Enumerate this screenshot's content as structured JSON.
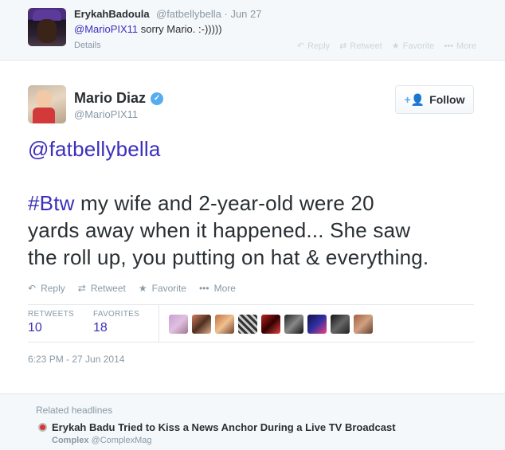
{
  "parent_tweet": {
    "name": "ErykahBadoula",
    "handle": "@fatbellybella",
    "date": "Jun 27",
    "mention": "@MarioPIX11",
    "text": " sorry Mario. :-)))))",
    "details_label": "Details",
    "actions": {
      "reply": "Reply",
      "retweet": "Retweet",
      "favorite": "Favorite",
      "more": "More"
    }
  },
  "main_tweet": {
    "name": "Mario Diaz",
    "handle": "@MarioPIX11",
    "follow_label": "Follow",
    "text_mention": "@fatbellybella",
    "hashtag": "#Btw",
    "line1_rest": " my wife and 2-year-old were 20",
    "line2": "yards away when it happened... She saw",
    "line3": "the roll up, you putting on hat & everything.",
    "actions": {
      "reply": "Reply",
      "retweet": "Retweet",
      "favorite": "Favorite",
      "more": "More"
    },
    "stats": {
      "retweets_label": "RETWEETS",
      "retweets_value": "10",
      "favorites_label": "FAVORITES",
      "favorites_value": "18"
    },
    "timestamp": "6:23 PM - 27 Jun 2014"
  },
  "related": {
    "title": "Related headlines",
    "headline": "Erykah Badu Tried to Kiss a News Anchor During a Live TV Broadcast",
    "source_name": "Complex",
    "source_handle": "@ComplexMag"
  },
  "colors": {
    "link": "#3b2fbd",
    "verified": "#55acee",
    "muted": "#8899a6"
  }
}
